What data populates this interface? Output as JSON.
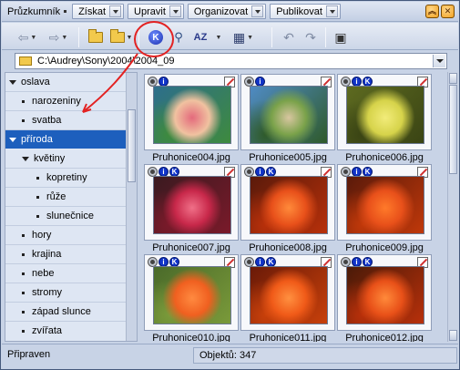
{
  "menubar": {
    "title": "Průzkumník",
    "menus": [
      "Získat",
      "Upravit",
      "Organizovat",
      "Publikovat"
    ],
    "window_buttons": [
      "chevron-up-icon",
      "close-icon"
    ]
  },
  "toolbar": {
    "icons": [
      "back-arrow-icon",
      "forward-arrow-icon",
      "folder-up-icon",
      "favorite-folder-icon",
      "keyword-k-icon",
      "find-icon",
      "sort-az-icon",
      "view-grid-icon",
      "rotate-left-icon",
      "rotate-right-icon",
      "slideshow-icon"
    ],
    "sort_label": "AZ"
  },
  "address": {
    "path": "C:\\Audrey\\Sony\\2004\\2004_09"
  },
  "tree": {
    "items": [
      {
        "label": "oslava",
        "level": 0,
        "expanded": true
      },
      {
        "label": "narozeniny",
        "level": 1
      },
      {
        "label": "svatba",
        "level": 1
      },
      {
        "label": "příroda",
        "level": 0,
        "expanded": true,
        "selected": true
      },
      {
        "label": "květiny",
        "level": 1,
        "expanded": true
      },
      {
        "label": "kopretiny",
        "level": 2
      },
      {
        "label": "růže",
        "level": 2
      },
      {
        "label": "slunečnice",
        "level": 2
      },
      {
        "label": "hory",
        "level": 1
      },
      {
        "label": "krajina",
        "level": 1
      },
      {
        "label": "nebe",
        "level": 1
      },
      {
        "label": "stromy",
        "level": 1
      },
      {
        "label": "západ slunce",
        "level": 1
      },
      {
        "label": "zvířata",
        "level": 1
      }
    ]
  },
  "thumbnails": [
    {
      "name": "Pruhonice004.jpg",
      "badges": [
        "camera",
        "i"
      ],
      "colors": [
        "#2d6e8c",
        "#f0c2a0",
        "#e46a7c",
        "#3e8a3e"
      ]
    },
    {
      "name": "Pruhonice005.jpg",
      "badges": [
        "camera",
        "i"
      ],
      "colors": [
        "#4f8bc4",
        "#7aa24a",
        "#d8c6a0",
        "#2f5a2a"
      ]
    },
    {
      "name": "Pruhonice006.jpg",
      "badges": [
        "camera",
        "i",
        "K"
      ],
      "colors": [
        "#5d6a20",
        "#d6d34a",
        "#f2ec7a",
        "#3a4414"
      ]
    },
    {
      "name": "Pruhonice007.jpg",
      "badges": [
        "camera",
        "i",
        "K"
      ],
      "colors": [
        "#3a1a20",
        "#c8284a",
        "#f07088",
        "#7a1a2a"
      ]
    },
    {
      "name": "Pruhonice008.jpg",
      "badges": [
        "camera",
        "i",
        "K"
      ],
      "colors": [
        "#5a1a0a",
        "#e8501a",
        "#ff8a3a",
        "#b8300a"
      ]
    },
    {
      "name": "Pruhonice009.jpg",
      "badges": [
        "camera",
        "i",
        "K"
      ],
      "colors": [
        "#5a1a0a",
        "#e8501a",
        "#ff7a2a",
        "#c0380a"
      ]
    },
    {
      "name": "Pruhonice010.jpg",
      "badges": [
        "camera",
        "i",
        "K"
      ],
      "colors": [
        "#4a6a2a",
        "#f06020",
        "#ff8a40",
        "#7a9a3a"
      ]
    },
    {
      "name": "Pruhonice011.jpg",
      "badges": [
        "camera",
        "i",
        "K"
      ],
      "colors": [
        "#6a1a08",
        "#f05a18",
        "#ff9040",
        "#c8400a"
      ]
    },
    {
      "name": "Pruhonice012.jpg",
      "badges": [
        "camera",
        "i",
        "K"
      ],
      "colors": [
        "#4a1a08",
        "#e85018",
        "#ff8a3a",
        "#b8300a"
      ]
    }
  ],
  "status": {
    "left": "Připraven",
    "right": "Objektů: 347"
  }
}
